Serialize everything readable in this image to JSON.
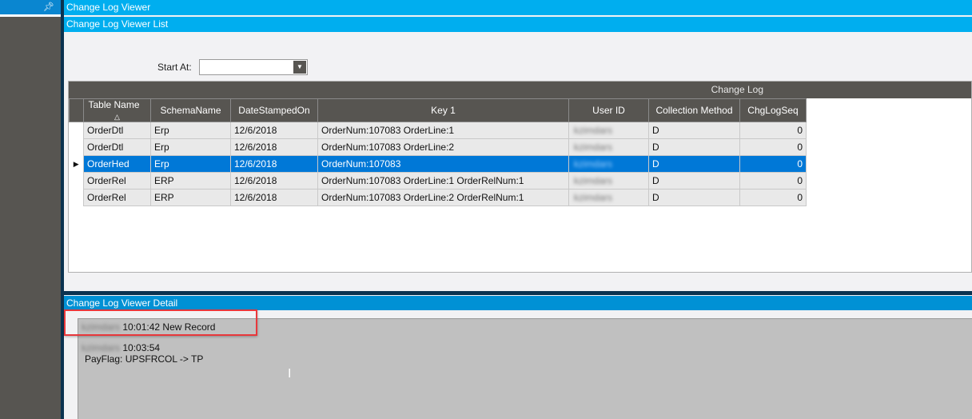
{
  "sidebar": {
    "pin_icon": "pin-icon"
  },
  "window": {
    "title": "Change Log Viewer"
  },
  "list": {
    "title": "Change Log Viewer List",
    "start_at_label": "Start At:",
    "start_at_value": "",
    "group_header": "Change Log",
    "columns": [
      "Table Name",
      "SchemaName",
      "DateStampedOn",
      "Key 1",
      "User ID",
      "Collection Method",
      "ChgLogSeq"
    ],
    "sort_column": "Table Name",
    "sort_icon": "sort-ascending-icon",
    "rows": [
      [
        "OrderDtl",
        "Erp",
        "12/6/2018",
        "OrderNum:107083 OrderLine:1",
        "kzimdars",
        "D",
        "0"
      ],
      [
        "OrderDtl",
        "Erp",
        "12/6/2018",
        "OrderNum:107083 OrderLine:2",
        "kzimdars",
        "D",
        "0"
      ],
      [
        "OrderHed",
        "Erp",
        "12/6/2018",
        "OrderNum:107083",
        "kzimdars",
        "D",
        "0"
      ],
      [
        "OrderRel",
        "ERP",
        "12/6/2018",
        "OrderNum:107083 OrderLine:1 OrderRelNum:1",
        "kzimdars",
        "D",
        "0"
      ],
      [
        "OrderRel",
        "ERP",
        "12/6/2018",
        "OrderNum:107083 OrderLine:2 OrderRelNum:1",
        "kzimdars",
        "D",
        "0"
      ]
    ],
    "selected_row": 2
  },
  "detail": {
    "title": "Change Log Viewer Detail",
    "entries": [
      {
        "user": "kzimdars",
        "text": "10:01:42 New Record"
      },
      {
        "user": "kzimdars",
        "text": "10:03:54",
        "change": "PayFlag: UPSFRCOL -> TP"
      }
    ]
  },
  "colors": {
    "title_bar": "#00aeef",
    "detail_bar": "#0091d5",
    "header": "#575551",
    "selection": "#0078d7",
    "highlight_box": "#e8383c"
  }
}
